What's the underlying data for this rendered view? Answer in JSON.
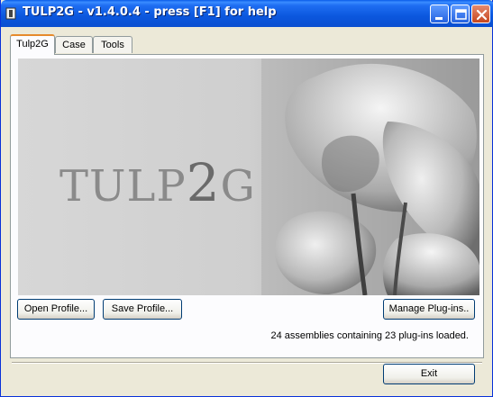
{
  "window": {
    "title": "TULP2G - v1.4.0.4 - press [F1] for help",
    "app_icon": "app-window-icon",
    "controls": [
      "minimize-icon",
      "maximize-icon",
      "close-icon"
    ]
  },
  "tabs": [
    {
      "label": "Tulp2G",
      "active": true
    },
    {
      "label": "Case",
      "active": false
    },
    {
      "label": "Tools",
      "active": false
    }
  ],
  "banner": {
    "logo_prefix": "TULP",
    "logo_digit": "2",
    "logo_suffix": "G"
  },
  "buttons": {
    "open_profile": "Open Profile...",
    "save_profile": "Save Profile...",
    "manage_plugins": "Manage  Plug-ins..",
    "exit": "Exit"
  },
  "status": "24 assemblies containing 23 plug-ins loaded.",
  "colors": {
    "titlebar": "#0A58E2",
    "window_bg": "#ECE9D8",
    "tab_accent": "#E68B2C"
  }
}
